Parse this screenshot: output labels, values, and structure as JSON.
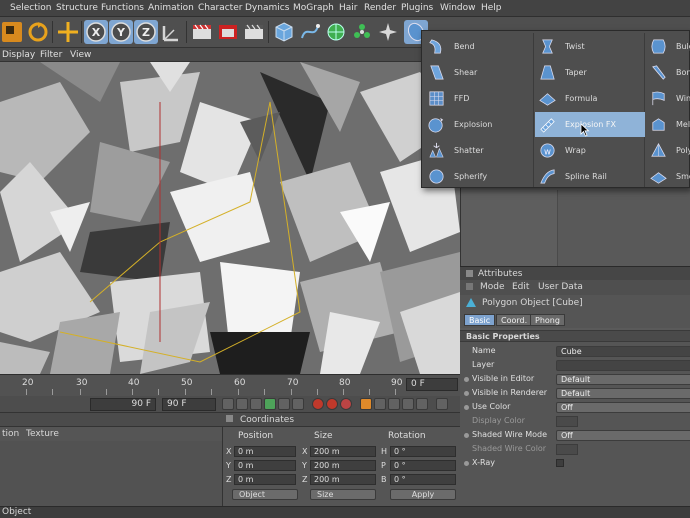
{
  "menubar": [
    "Selection",
    "Structure",
    "Functions",
    "Animation",
    "Character",
    "Dynamics",
    "MoGraph",
    "Hair",
    "Render",
    "Plugins",
    "Window",
    "Help"
  ],
  "viewport_menu": [
    "Display",
    "Filter",
    "View"
  ],
  "timeline": {
    "ticks": [
      "20",
      "30",
      "40",
      "50",
      "60",
      "70",
      "80",
      "90"
    ],
    "current_frame": "0 F"
  },
  "transport": {
    "end_frame_left": "90 F",
    "end_frame_right": "90 F"
  },
  "material_manager": {
    "tabs": [
      "tion",
      "Texture"
    ]
  },
  "coordinates": {
    "title": "Coordinates",
    "headers": [
      "Position",
      "Size",
      "Rotation"
    ],
    "rows": [
      {
        "pos_label": "X",
        "pos": "0 m",
        "size_label": "X",
        "size": "200 m",
        "rot_label": "H",
        "rot": "0 °"
      },
      {
        "pos_label": "Y",
        "pos": "0 m",
        "size_label": "Y",
        "size": "200 m",
        "rot_label": "P",
        "rot": "0 °"
      },
      {
        "pos_label": "Z",
        "pos": "0 m",
        "size_label": "Z",
        "size": "200 m",
        "rot_label": "B",
        "rot": "0 °"
      }
    ],
    "mode_dropdown": "Object",
    "size_dropdown": "Size",
    "apply_label": "Apply"
  },
  "statusbar": {
    "text": "Object"
  },
  "attributes": {
    "title": "Attributes",
    "menu": [
      "Mode",
      "Edit",
      "User Data"
    ],
    "object_label": "Polygon Object [Cube]",
    "tabs": [
      "Basic",
      "Coord.",
      "Phong"
    ],
    "active_tab": "Basic",
    "section": "Basic Properties",
    "rows": [
      {
        "label": "Name",
        "value": "Cube",
        "dim": false,
        "dot": false,
        "kind": "field"
      },
      {
        "label": "Layer",
        "value": "",
        "dim": false,
        "dot": false,
        "kind": "field"
      },
      {
        "label": "Visible in Editor",
        "value": "Default",
        "dim": false,
        "dot": true,
        "kind": "dropdown"
      },
      {
        "label": "Visible in Renderer",
        "value": "Default",
        "dim": false,
        "dot": true,
        "kind": "dropdown"
      },
      {
        "label": "Use Color",
        "value": "Off",
        "dim": false,
        "dot": true,
        "kind": "dropdown"
      },
      {
        "label": "Display Color",
        "value": "",
        "dim": true,
        "dot": false,
        "kind": "swatch"
      },
      {
        "label": "Shaded Wire Mode",
        "value": "Off",
        "dim": false,
        "dot": true,
        "kind": "dropdown"
      },
      {
        "label": "Shaded Wire Color",
        "value": "",
        "dim": true,
        "dot": false,
        "kind": "swatch"
      },
      {
        "label": "X-Ray",
        "value": "",
        "dim": false,
        "dot": true,
        "kind": "checkbox"
      }
    ]
  },
  "deformer_menu": {
    "columns": [
      [
        "Bend",
        "Shear",
        "FFD",
        "Explosion",
        "Shatter",
        "Spherify"
      ],
      [
        "Twist",
        "Taper",
        "Formula",
        "Explosion FX",
        "Wrap",
        "Spline Rail"
      ],
      [
        "Bulg",
        "Bone",
        "Wind",
        "Melt",
        "Poly",
        "Smo"
      ]
    ],
    "highlighted": "Explosion FX"
  }
}
